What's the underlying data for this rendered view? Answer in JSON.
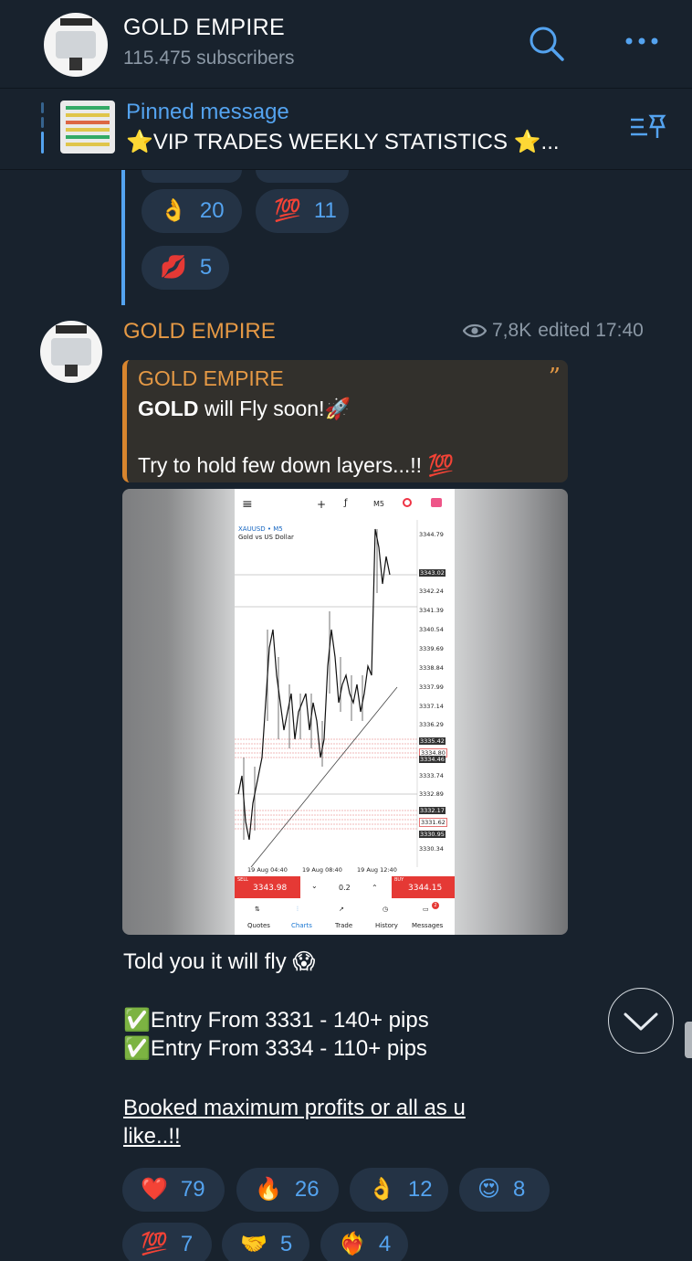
{
  "header": {
    "title": "GOLD EMPIRE",
    "subscribers": "115.475 subscribers",
    "search_icon": "search-icon",
    "more_icon": "more-dots-icon"
  },
  "pinned": {
    "title": "Pinned message",
    "text": "⭐VIP TRADES WEEKLY STATISTICS ⭐...",
    "list_icon": "pinned-list-icon"
  },
  "previous_reactions": [
    {
      "emoji": "👌",
      "count": "20"
    },
    {
      "emoji": "💯",
      "count": "11"
    },
    {
      "emoji": "💋",
      "count": "5"
    }
  ],
  "message": {
    "author": "GOLD EMPIRE",
    "views": "7,8K",
    "edited": "edited 17:40",
    "quote": {
      "name": "GOLD EMPIRE",
      "bold": "GOLD",
      "line1_rest": " will Fly soon!🚀",
      "line2": "Try to hold few down layers...!! ",
      "line2_emoji": "💯"
    },
    "screenshot": {
      "symbol": "XAUUSD • M5",
      "instrument": "Gold vs US Dollar",
      "timeframe": "M5",
      "prices": [
        "3344.79",
        "3343.02",
        "3342.24",
        "3341.39",
        "3340.54",
        "3339.69",
        "3338.84",
        "3337.99",
        "3337.14",
        "3336.29",
        "3335.42",
        "3334.80",
        "3334.46",
        "3333.74",
        "3332.89",
        "3332.17",
        "3331.62",
        "3330.95",
        "3330.34"
      ],
      "times": [
        "19 Aug 04:40",
        "19 Aug 08:40",
        "19 Aug 12:40"
      ],
      "sell_label": "SELL",
      "sell_price": "3343.98",
      "buy_label": "BUY",
      "buy_price": "3344.15",
      "lot": "0.2",
      "nav": [
        "Quotes",
        "Charts",
        "Trade",
        "History",
        "Messages"
      ],
      "messages_badge": "2"
    },
    "line1": "Told you it will fly 😱",
    "entry1": "Entry From 3331 - 140+ pips",
    "entry2": "Entry From 3334 - 110+ pips",
    "link_line1": "Booked maximum profits or all as u",
    "link_line2": "like..!!",
    "check_emoji": "✅"
  },
  "reactions": [
    {
      "emoji": "❤️",
      "count": "79"
    },
    {
      "emoji": "🔥",
      "count": "26"
    },
    {
      "emoji": "👌",
      "count": "12"
    },
    {
      "emoji": "😍",
      "count": "8"
    },
    {
      "emoji": "💯",
      "count": "7"
    },
    {
      "emoji": "🤝",
      "count": "5"
    },
    {
      "emoji": "❤️‍🔥",
      "count": "4"
    }
  ],
  "colors": {
    "background": "#18222d",
    "accent": "#54a3ef",
    "author": "#e59945",
    "reaction_bg": "#243345"
  }
}
